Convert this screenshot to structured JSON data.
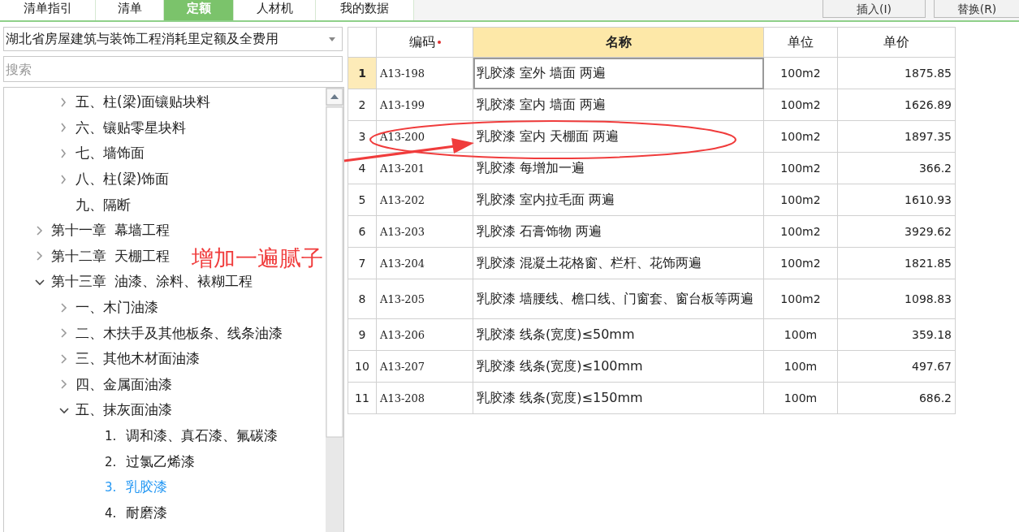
{
  "tabs": [
    {
      "label": "清单指引",
      "selected": false
    },
    {
      "label": "清单",
      "selected": false
    },
    {
      "label": "定额",
      "selected": true
    },
    {
      "label": "人材机",
      "selected": false
    },
    {
      "label": "我的数据",
      "selected": false
    }
  ],
  "buttons": [
    "插入(I)",
    "替换(R)"
  ],
  "library_select": {
    "value": "湖北省房屋建筑与装饰工程消耗里定额及全费用"
  },
  "search": {
    "placeholder": "搜索"
  },
  "tree": {
    "continued_children": [
      {
        "number": "五、",
        "label": "柱(梁)面镶贴块料",
        "expanded": false
      },
      {
        "number": "六、",
        "label": "镶贴零星块料",
        "expanded": false
      },
      {
        "number": "七、",
        "label": "墙饰面",
        "expanded": false
      },
      {
        "number": "八、",
        "label": "柱(梁)饰面",
        "expanded": false
      },
      {
        "number": "九、",
        "label": "隔断"
      }
    ],
    "items": [
      {
        "number": "第十一章",
        "label": "幕墙工程",
        "expanded": false
      },
      {
        "number": "第十二章",
        "label": "天棚工程",
        "expanded": false
      },
      {
        "number": "第十三章",
        "label": "油漆、涂料、裱糊工程",
        "expanded": true,
        "children": [
          {
            "number": "一、",
            "label": "木门油漆",
            "expanded": false
          },
          {
            "number": "二、",
            "label": "木扶手及其他板条、线条油漆",
            "expanded": false
          },
          {
            "number": "三、",
            "label": "其他木材面油漆",
            "expanded": false
          },
          {
            "number": "四、",
            "label": "金属面油漆",
            "expanded": false
          },
          {
            "number": "五、",
            "label": "抹灰面油漆",
            "expanded": true,
            "children": [
              {
                "number": "1.",
                "label": "调和漆、真石漆、氟碳漆",
                "selected": false
              },
              {
                "number": "2.",
                "label": "过氯乙烯漆",
                "selected": false
              },
              {
                "number": "3.",
                "label": "乳胶漆",
                "selected": true
              },
              {
                "number": "4.",
                "label": "耐磨漆",
                "selected": false
              }
            ]
          }
        ]
      }
    ]
  },
  "table": {
    "columns": [
      {
        "label": "编码",
        "required": true,
        "selected": false
      },
      {
        "label": "名称",
        "required": false,
        "selected": true
      },
      {
        "label": "单位",
        "required": false,
        "selected": false
      },
      {
        "label": "单价",
        "required": false,
        "selected": false
      }
    ],
    "rows": [
      {
        "index": "1",
        "code": "A13-198",
        "name": "乳胶漆 室外 墙面 两遍",
        "unit": "100m2",
        "price": "1875.85",
        "selected": true
      },
      {
        "index": "2",
        "code": "A13-199",
        "name": "乳胶漆 室内 墙面 两遍",
        "unit": "100m2",
        "price": "1626.89",
        "selected": false
      },
      {
        "index": "3",
        "code": "A13-200",
        "name": "乳胶漆 室内 天棚面 两遍",
        "unit": "100m2",
        "price": "1897.35",
        "selected": false
      },
      {
        "index": "4",
        "code": "A13-201",
        "name": "乳胶漆 每增加一遍",
        "unit": "100m2",
        "price": "366.2",
        "selected": false
      },
      {
        "index": "5",
        "code": "A13-202",
        "name": "乳胶漆 室内拉毛面 两遍",
        "unit": "100m2",
        "price": "1610.93",
        "selected": false
      },
      {
        "index": "6",
        "code": "A13-203",
        "name": "乳胶漆 石膏饰物 两遍",
        "unit": "100m2",
        "price": "3929.62",
        "selected": false
      },
      {
        "index": "7",
        "code": "A13-204",
        "name": "乳胶漆 混凝土花格窗、栏杆、花饰两遍",
        "unit": "100m2",
        "price": "1821.85",
        "selected": false
      },
      {
        "index": "8",
        "code": "A13-205",
        "name": "乳胶漆 墙腰线、檐口线、门窗套、窗台板等两遍",
        "unit": "100m2",
        "price": "1098.83",
        "selected": false
      },
      {
        "index": "9",
        "code": "A13-206",
        "name": "乳胶漆 线条(宽度)≤50mm",
        "unit": "100m",
        "price": "359.18",
        "selected": false
      },
      {
        "index": "10",
        "code": "A13-207",
        "name": "乳胶漆 线条(宽度)≤100mm",
        "unit": "100m",
        "price": "497.67",
        "selected": false
      },
      {
        "index": "11",
        "code": "A13-208",
        "name": "乳胶漆 线条(宽度)≤150mm",
        "unit": "100m",
        "price": "686.2",
        "selected": false
      }
    ]
  },
  "annotation": {
    "text": "增加一遍腻子"
  }
}
